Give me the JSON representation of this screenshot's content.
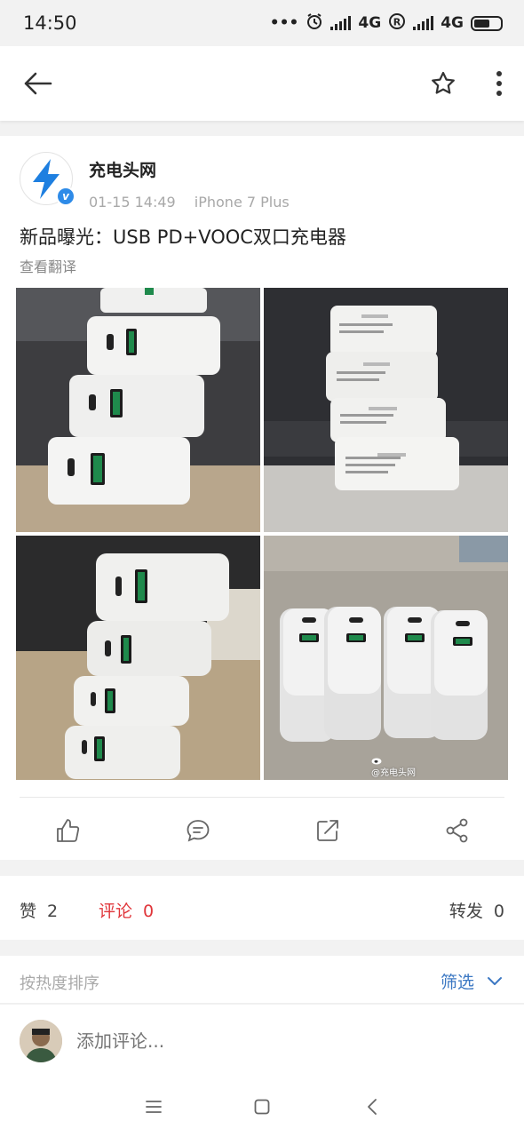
{
  "status_bar": {
    "time": "14:50",
    "dots": "•••",
    "network1": "4G",
    "network2": "4G",
    "network2_sup": "ᵢₗ"
  },
  "topbar": {
    "back_icon": "arrow-left-icon",
    "star_icon": "star-outline-icon",
    "more_icon": "more-vertical-icon"
  },
  "post": {
    "author": "充电头网",
    "verified_badge": "v",
    "date": "01-15 14:49",
    "device": "iPhone 7 Plus",
    "text": "新品曝光：USB PD+VOOC双口充电器",
    "translate": "查看翻译",
    "watermark": "充电头网",
    "photos": [
      "photo-stacked-chargers-front",
      "photo-stacked-chargers-label",
      "photo-stacked-chargers-side",
      "photo-chargers-row-top"
    ]
  },
  "actions": {
    "like_icon": "thumbs-up-icon",
    "comment_icon": "comment-bubble-icon",
    "repost_icon": "repost-icon",
    "share_icon": "share-icon"
  },
  "stats": {
    "like_label": "赞",
    "like_count": "2",
    "comment_label": "评论",
    "comment_count": "0",
    "repost_label": "转发",
    "repost_count": "0"
  },
  "sort": {
    "label": "按热度排序",
    "filter": "筛选"
  },
  "comment_box": {
    "placeholder": "添加评论..."
  },
  "colors": {
    "accent_red": "#e0353a",
    "link_blue": "#3c78c3",
    "verified_blue": "#2e8be8"
  }
}
